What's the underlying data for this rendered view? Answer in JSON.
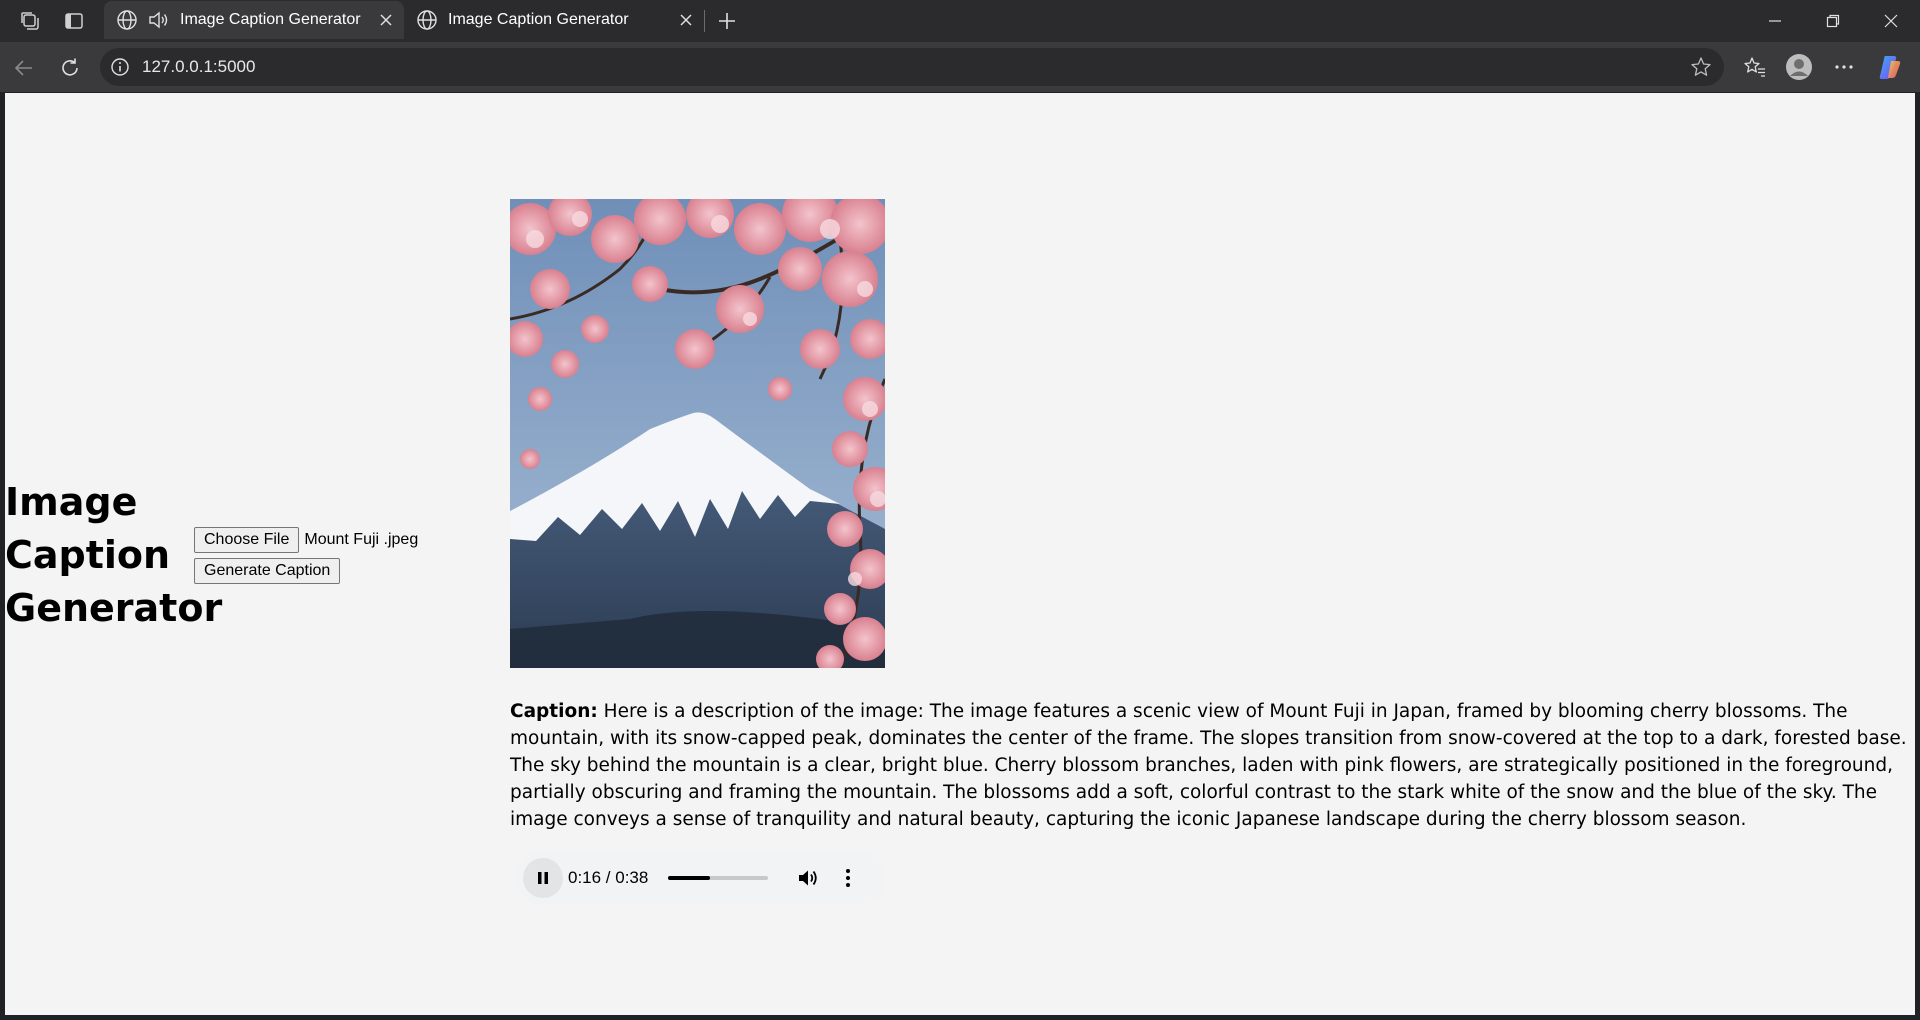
{
  "browser": {
    "tabs": [
      {
        "title": "Image Caption Generator",
        "active": true,
        "playing_audio": true
      },
      {
        "title": "Image Caption Generator",
        "active": false,
        "playing_audio": false
      }
    ],
    "url": "127.0.0.1:5000",
    "icons": {
      "workspaces": "workspaces-icon",
      "tab_actions": "tab-actions-icon",
      "back": "back-arrow-icon",
      "refresh": "refresh-icon",
      "site_info": "info-icon",
      "favorite": "star-icon",
      "favorites": "favorites-icon",
      "profile": "avatar-icon",
      "menu": "more-horizontal-icon",
      "copilot": "copilot-icon"
    }
  },
  "page": {
    "title": "Image Caption Generator",
    "file_button": "Choose File",
    "file_name": "Mount Fuji .jpeg",
    "generate_button": "Generate Caption",
    "caption_label": "Caption:",
    "caption_text": "Here is a description of the image: The image features a scenic view of Mount Fuji in Japan, framed by blooming cherry blossoms. The mountain, with its snow-capped peak, dominates the center of the frame. The slopes transition from snow-covered at the top to a dark, forested base. The sky behind the mountain is a clear, bright blue. Cherry blossom branches, laden with pink flowers, are strategically positioned in the foreground, partially obscuring and framing the mountain. The blossoms add a soft, colorful contrast to the stark white of the snow and the blue of the sky. The image conveys a sense of tranquility and natural beauty, capturing the iconic Japanese landscape during the cherry blossom season.",
    "audio": {
      "time_display": "0:16 / 0:38",
      "progress_fraction": 0.42,
      "state": "playing"
    }
  },
  "colors": {
    "page_background": "#f4f4f4",
    "browser_frame": "#2b2b2e",
    "sky": "#7f9bbd",
    "blossom": "#e7a3ae"
  }
}
